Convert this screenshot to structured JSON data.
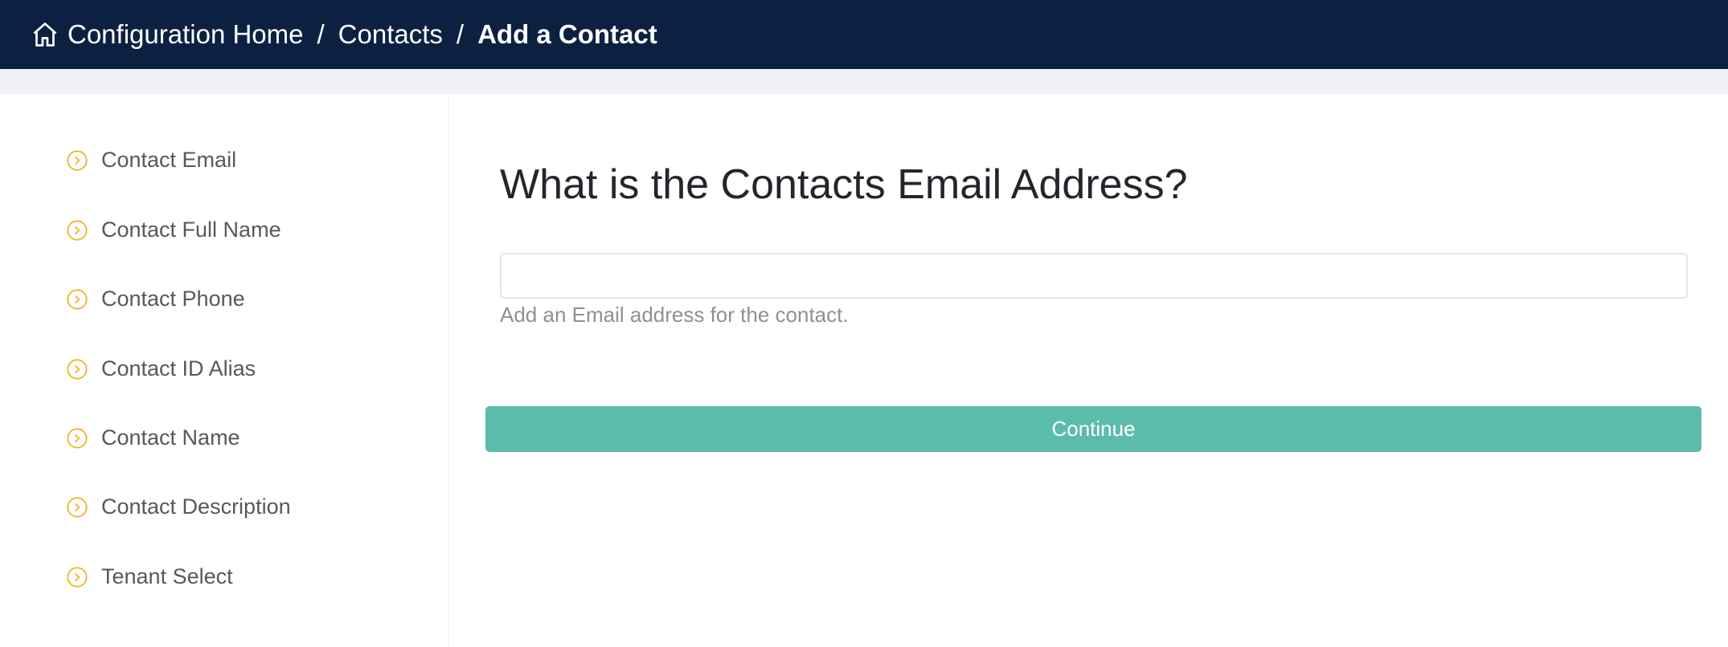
{
  "header": {
    "breadcrumbs": [
      "Configuration Home",
      "Contacts",
      "Add a Contact"
    ],
    "separator": "/"
  },
  "sidebar": {
    "items": [
      {
        "label": "Contact Email",
        "icon": "chevron-circle-icon"
      },
      {
        "label": "Contact Full Name",
        "icon": "chevron-circle-icon"
      },
      {
        "label": "Contact Phone",
        "icon": "chevron-circle-icon"
      },
      {
        "label": "Contact ID Alias",
        "icon": "chevron-circle-icon"
      },
      {
        "label": "Contact Name",
        "icon": "chevron-circle-icon"
      },
      {
        "label": "Contact Description",
        "icon": "chevron-circle-icon"
      },
      {
        "label": "Tenant Select",
        "icon": "chevron-circle-icon"
      }
    ]
  },
  "main": {
    "title": "What is the Contacts Email Address?",
    "email_value": "",
    "email_placeholder": "",
    "help_text": "Add an Email address for the contact.",
    "continue_label": "Continue"
  },
  "colors": {
    "header_bg": "#0c2142",
    "accent_yellow": "#f0b429",
    "continue_bg": "#5bbcab"
  }
}
